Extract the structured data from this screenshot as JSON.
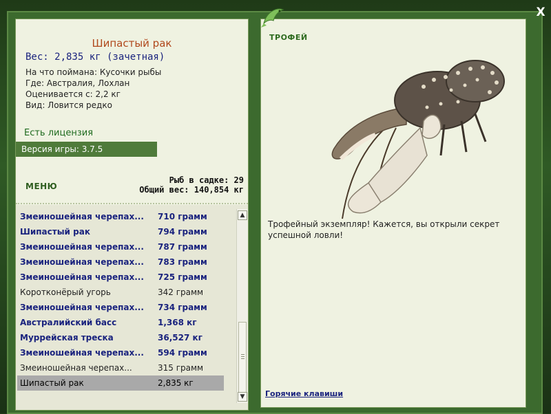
{
  "fish": {
    "title": "Шипастый рак",
    "weight": "Вес: 2,835 кг (зачетная)",
    "caught_on": "На что поймана: Кусочки рыбы",
    "location": "Где: Австралия, Лохлан",
    "valued": "Оценивается с: 2,2 кг",
    "kind": "Вид: Ловится редко"
  },
  "license": "Есть лицензия",
  "version": "Версия игры: 3.7.5",
  "menu_label": "МЕНЮ",
  "stats": {
    "in_keepnet": "Рыб в садке: 29",
    "total_weight": "Общий вес: 140,854 кг"
  },
  "catch_list": [
    {
      "name": "Змеиношейная черепах...",
      "weight": "710 грамм",
      "style": "bold"
    },
    {
      "name": "Шипастый рак",
      "weight": "794 грамм",
      "style": "bold"
    },
    {
      "name": "Змеиношейная черепах...",
      "weight": "787 грамм",
      "style": "bold"
    },
    {
      "name": "Змеиношейная черепах...",
      "weight": "783 грамм",
      "style": "bold"
    },
    {
      "name": "Змеиношейная черепах...",
      "weight": "725 грамм",
      "style": "bold"
    },
    {
      "name": "Коротконёрый угорь",
      "weight": "342 грамм",
      "style": "plain"
    },
    {
      "name": "Змеиношейная черепах...",
      "weight": "734 грамм",
      "style": "bold"
    },
    {
      "name": "Австралийский басс",
      "weight": "1,368 кг",
      "style": "bold"
    },
    {
      "name": "Муррейская треска",
      "weight": "36,527 кг",
      "style": "bold"
    },
    {
      "name": "Змеиношейная черепах...",
      "weight": "594 грамм",
      "style": "bold"
    },
    {
      "name": "Змеиношейная черепах...",
      "weight": "315 грамм",
      "style": "plain"
    },
    {
      "name": "Шипастый рак",
      "weight": "2,835 кг",
      "style": "selected"
    }
  ],
  "scroll_up_icon": "chevron-up-icon",
  "scroll_down_icon": "chevron-down-icon",
  "trophy_label": "ТРОФЕЙ",
  "trophy_icon": "fish-emblem-icon",
  "description": "Трофейный экземпляр! Кажется, вы открыли секрет успешной ловли!",
  "hotkeys": "Горячие клавиши",
  "close_icon": "close-icon",
  "close_glyph": "X",
  "colors": {
    "frame": "#3c6a2e",
    "panel": "#eff2e1",
    "title": "#b0481c",
    "bold_text": "#1a237e",
    "license": "#1f6b1f",
    "selected_row": "#a9a9a9"
  }
}
